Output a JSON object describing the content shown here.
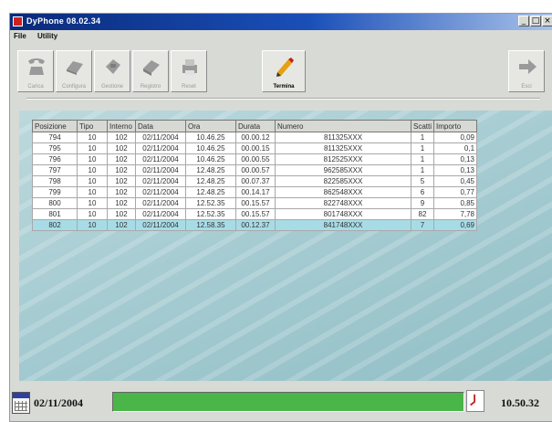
{
  "window": {
    "title": "DyPhone 08.02.34"
  },
  "menu": [
    "File",
    "Utility"
  ],
  "toolbar": {
    "buttons": [
      {
        "label": "Carica",
        "icon": "phone-icon"
      },
      {
        "label": "Configura",
        "icon": "config-icon"
      },
      {
        "label": "Gestione",
        "icon": "manage-icon"
      },
      {
        "label": "Registro",
        "icon": "register-icon"
      },
      {
        "label": "Reset",
        "icon": "printer-icon"
      },
      {
        "label": "Termina",
        "icon": "pencil-icon"
      },
      {
        "label": "Esci",
        "icon": "exit-arrow-icon"
      }
    ]
  },
  "table": {
    "columns": [
      "Posizione",
      "Tipo",
      "Interno",
      "Data",
      "Ora",
      "Durata",
      "Numero",
      "Scatti",
      "Importo"
    ],
    "rows": [
      [
        "794",
        "10",
        "102",
        "02/11/2004",
        "10.46.25",
        "00.00.12",
        "811325XXX",
        "1",
        "0,09"
      ],
      [
        "795",
        "10",
        "102",
        "02/11/2004",
        "10.46.25",
        "00.00.15",
        "811325XXX",
        "1",
        "0,1"
      ],
      [
        "796",
        "10",
        "102",
        "02/11/2004",
        "10.46.25",
        "00.00.55",
        "812525XXX",
        "1",
        "0,13"
      ],
      [
        "797",
        "10",
        "102",
        "02/11/2004",
        "12.48.25",
        "00.00.57",
        "962585XXX",
        "1",
        "0,13"
      ],
      [
        "798",
        "10",
        "102",
        "02/11/2004",
        "12.48.25",
        "00.07.37",
        "822585XXX",
        "5",
        "0,45"
      ],
      [
        "799",
        "10",
        "102",
        "02/11/2004",
        "12.48.25",
        "00.14.17",
        "862548XXX",
        "6",
        "0,77"
      ],
      [
        "800",
        "10",
        "102",
        "02/11/2004",
        "12.52.35",
        "00.15.57",
        "822748XXX",
        "9",
        "0,85"
      ],
      [
        "801",
        "10",
        "102",
        "02/11/2004",
        "12.52.35",
        "00.15.57",
        "801748XXX",
        "82",
        "7,78"
      ],
      [
        "802",
        "10",
        "102",
        "02/11/2004",
        "12.58.35",
        "00.12.37",
        "841748XXX",
        "7",
        "0,69"
      ]
    ],
    "selected_row": 8
  },
  "status": {
    "date": "02/11/2004",
    "time": "10.50.32",
    "progress_percent": 100,
    "progress_color": "#4ab548"
  }
}
